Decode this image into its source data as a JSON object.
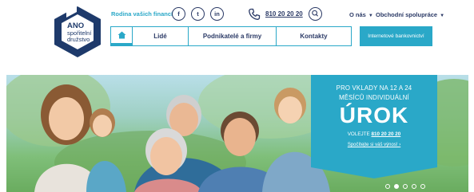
{
  "logo": {
    "name": "ANO",
    "line1": "spořitelní",
    "line2": "družstvo"
  },
  "topbar": {
    "tagline": "Rodina vašich financí",
    "social": [
      "f",
      "t",
      "in"
    ],
    "phone": "810 20 20 20",
    "links": [
      {
        "label": "O nás"
      },
      {
        "label": "Obchodní spolupráce"
      }
    ]
  },
  "nav": {
    "items": [
      "Lidé",
      "Podnikatelé a firmy",
      "Kontakty"
    ]
  },
  "banking_button": "Internetové bankovnictví",
  "promo": {
    "line1": "PRO VKLADY NA 12 A 24",
    "line2": "MĚSÍCŮ INDIVIDUÁLNÍ",
    "headline": "ÚROK",
    "call_prefix": "VOLEJTE",
    "call_number": "810 20 20 20",
    "cta": "Spočítejte si váš výnos!",
    "cta_arrow": "›"
  },
  "carousel": {
    "slides": 5,
    "active": 2
  },
  "colors": {
    "accent": "#2aa8c8",
    "navy": "#2b3a66"
  }
}
